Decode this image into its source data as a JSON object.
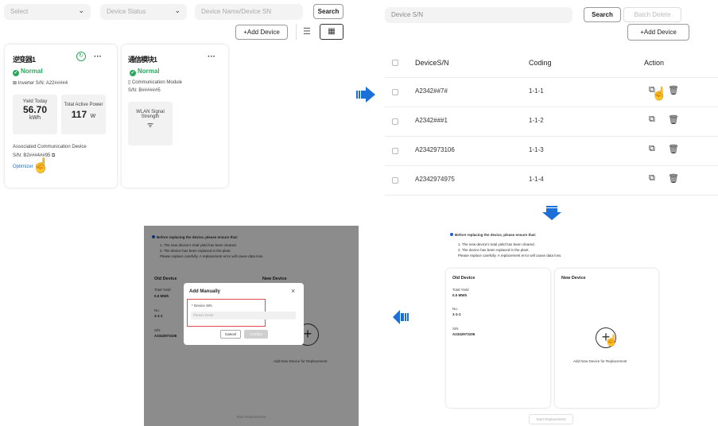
{
  "panel1": {
    "filters": {
      "select_placeholder": "Select",
      "status_placeholder": "Device Status",
      "search_placeholder": "Device Name/Device SN"
    },
    "search_label": "Search",
    "add_device_label": "+Add Device",
    "card1": {
      "title": "逆变器1",
      "more": "···",
      "status": "Normal",
      "sn_label": "Inverter S/N: A22####4",
      "yield_label": "Yield Today",
      "yield_value": "56.70",
      "yield_unit": "kWh",
      "power_label": "Total Active Power",
      "power_value": "117",
      "power_unit": "W",
      "assoc_label": "Associated Communication Device",
      "assoc_sn": "S/N: B2###4##95",
      "optimizer_link": "Optimizer"
    },
    "card2": {
      "title": "通信模块1",
      "more": "···",
      "status": "Normal",
      "type_label": "Communication Module",
      "sn_label": "S/N: B######5",
      "wlan_label": "WLAN Signal Strength"
    }
  },
  "panel2": {
    "search_placeholder": "Device S/N",
    "search_label": "Search",
    "batch_delete_label": "Batch Delete",
    "add_device_label": "+Add Device",
    "columns": [
      "DeviceS/N",
      "Coding",
      "Action"
    ],
    "rows": [
      {
        "sn": "A2342##7#",
        "coding": "1-1-1"
      },
      {
        "sn": "A2342###1",
        "coding": "1-1-2"
      },
      {
        "sn": "A2342973106",
        "coding": "1-1-3"
      },
      {
        "sn": "A2342974975",
        "coding": "1-1-4"
      }
    ]
  },
  "panel4": {
    "notice_title": "Before replacing the device, please ensure that:",
    "notice_lines": [
      "1. The new device's total yield has been cleared.",
      "2. The device has been replaced in the plant.",
      "Please replace carefully. A replacement error will cause data loss."
    ],
    "old_device_title": "Old Device",
    "new_device_title": "New Device",
    "total_yield_label": "Total Yield",
    "total_yield_value": "0.0 MWh",
    "no_label": "No.",
    "no_value": "1-1-1",
    "sn_label": "S/N",
    "sn_value": "A2342973106",
    "add_new_label": "Add New Device for Replacement",
    "start_label": "Start Replacement"
  },
  "panel3": {
    "notice_title": "Before replacing the device, please ensure that:",
    "notice_lines": [
      "1. The new device's total yield has been cleared.",
      "2. The device has been replaced in the plant.",
      "Please replace carefully. A replacement error will cause data loss."
    ],
    "old_device_title": "Old Device",
    "new_device_title": "New Device",
    "total_yield_label": "Total Yield",
    "total_yield_value": "0.0 MWh",
    "no_label": "No.",
    "no_value": "1-1-1",
    "sn_label": "S/N",
    "sn_value": "A2342973106",
    "add_new_label": "Add New Device for Replacement",
    "start_label": "Start Replacement",
    "modal": {
      "title": "Add Manually",
      "close": "×",
      "field_label": "* Device S/N",
      "field_placeholder": "Please Enter",
      "cancel_label": "Cancel",
      "confirm_label": "Confirm"
    }
  },
  "colors": {
    "accent_blue": "#1a6fd9",
    "normal_green": "#2aa85c",
    "highlight_red": "#e04a4a"
  }
}
